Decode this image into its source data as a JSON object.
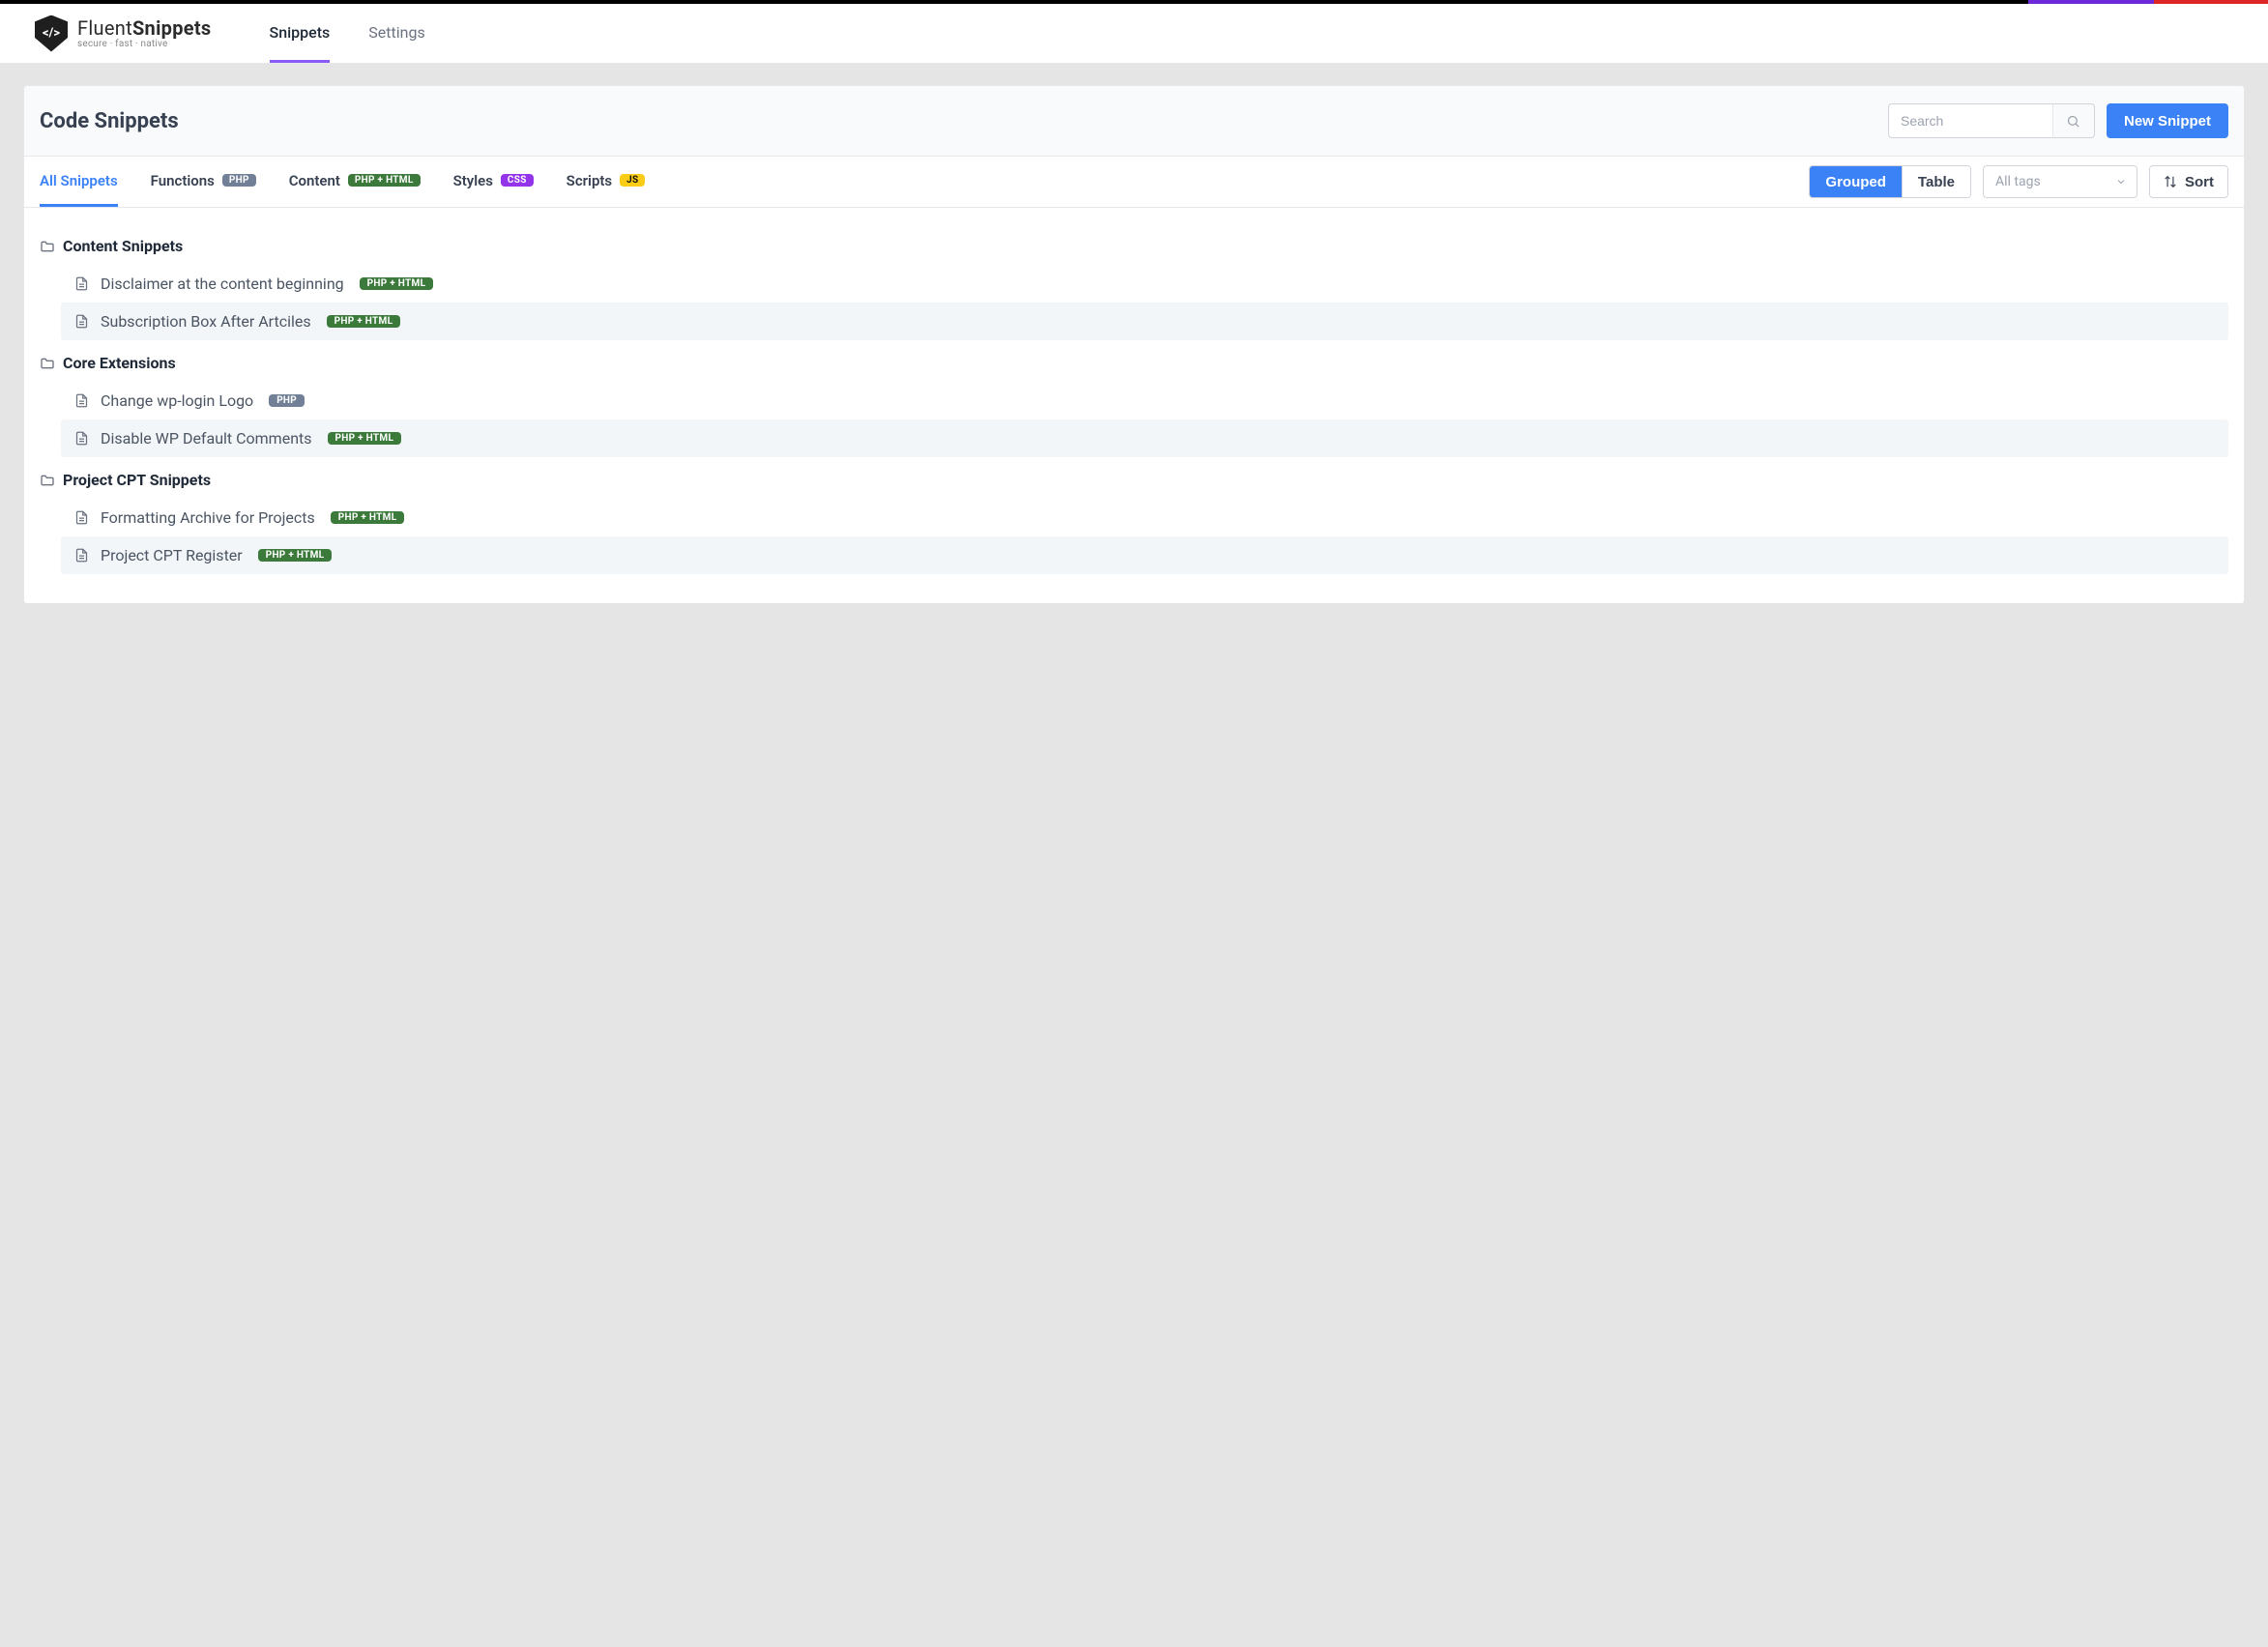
{
  "brand": {
    "name_light": "Fluent",
    "name_bold": "Snippets",
    "tagline": "secure · fast · native",
    "logo_glyph": "</>"
  },
  "main_nav": {
    "snippets": "Snippets",
    "settings": "Settings",
    "active": "snippets"
  },
  "page": {
    "title": "Code Snippets",
    "search_placeholder": "Search",
    "new_button": "New Snippet"
  },
  "filter_tabs": {
    "all": {
      "label": "All Snippets"
    },
    "functions": {
      "label": "Functions",
      "badge": "PHP",
      "badge_class": "php"
    },
    "content": {
      "label": "Content",
      "badge": "PHP + HTML",
      "badge_class": "phtml"
    },
    "styles": {
      "label": "Styles",
      "badge": "CSS",
      "badge_class": "css"
    },
    "scripts": {
      "label": "Scripts",
      "badge": "JS",
      "badge_class": "js"
    },
    "active": "all"
  },
  "controls": {
    "view_grouped": "Grouped",
    "view_table": "Table",
    "view_active": "grouped",
    "tags_placeholder": "All tags",
    "sort_label": "Sort"
  },
  "groups": [
    {
      "name": "Content Snippets",
      "items": [
        {
          "title": "Disclaimer at the content beginning",
          "badge": "PHP + HTML",
          "badge_class": "phtml"
        },
        {
          "title": "Subscription Box After Artciles",
          "badge": "PHP + HTML",
          "badge_class": "phtml"
        }
      ]
    },
    {
      "name": "Core Extensions",
      "items": [
        {
          "title": "Change wp-login Logo",
          "badge": "PHP",
          "badge_class": "php"
        },
        {
          "title": "Disable WP Default Comments",
          "badge": "PHP + HTML",
          "badge_class": "phtml"
        }
      ]
    },
    {
      "name": "Project CPT Snippets",
      "items": [
        {
          "title": "Formatting Archive for Projects",
          "badge": "PHP + HTML",
          "badge_class": "phtml"
        },
        {
          "title": "Project CPT Register",
          "badge": "PHP + HTML",
          "badge_class": "phtml"
        }
      ]
    }
  ]
}
